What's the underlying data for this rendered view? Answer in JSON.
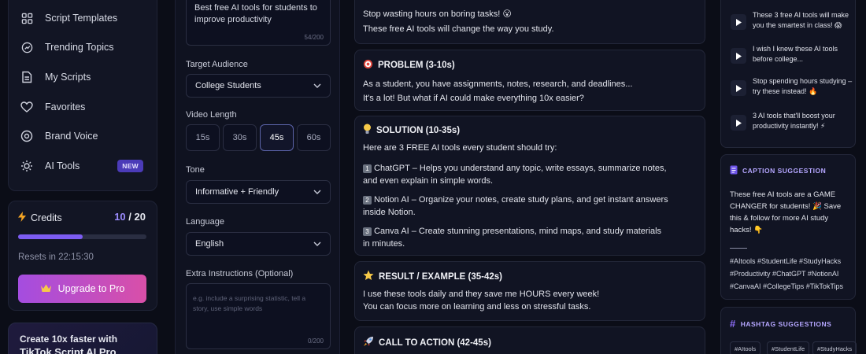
{
  "sidebar": {
    "items": [
      {
        "label": "Script Templates",
        "icon": "grid-icon"
      },
      {
        "label": "Trending Topics",
        "icon": "trending-icon"
      },
      {
        "label": "My Scripts",
        "icon": "document-icon"
      },
      {
        "label": "Favorites",
        "icon": "heart-icon"
      },
      {
        "label": "Brand Voice",
        "icon": "brand-icon"
      },
      {
        "label": "AI Tools",
        "icon": "sparkle-icon",
        "badge": "NEW"
      }
    ]
  },
  "credits": {
    "title": "Credits",
    "used": "10",
    "separator": "/",
    "total": "20",
    "progress_fraction": 0.5,
    "reset_text": "Resets in 22:15:30",
    "upgrade_label": "Upgrade to Pro"
  },
  "promo": {
    "line1": "Create 10x faster with",
    "line2": "TikTok Script AI Pro"
  },
  "form": {
    "topic_value": "Best free AI tools for students to improve productivity",
    "topic_count": "54/200",
    "audience_label": "Target Audience",
    "audience_value": "College Students",
    "length_label": "Video Length",
    "lengths": [
      "15s",
      "30s",
      "45s",
      "60s"
    ],
    "length_selected": "45s",
    "tone_label": "Tone",
    "tone_value": "Informative + Friendly",
    "language_label": "Language",
    "language_value": "English",
    "extra_label": "Extra Instructions (Optional)",
    "extra_placeholder": "e.g. include a surprising statistic, tell a story, use simple words",
    "extra_count": "0/200"
  },
  "script": {
    "hook_line1": "Stop wasting hours on boring tasks! 😮",
    "hook_line2": "These free AI tools will change the way you study.",
    "problem_title": "PROBLEM (3-10s)",
    "problem_line1": "As a student, you have assignments, notes, research, and deadlines...",
    "problem_line2": "It's a lot! But what if AI could make everything 10x easier?",
    "solution_title": "SOLUTION (10-35s)",
    "solution_intro": "Here are 3 FREE AI tools every student should try:",
    "tool1_num": "1",
    "tool1_line1": "ChatGPT – Helps you understand any topic, write essays, summarize notes,",
    "tool1_line2": "and even explain in simple words.",
    "tool2_num": "2",
    "tool2_line1": "Notion AI – Organize your notes, create study plans, and get instant answers",
    "tool2_line2": "inside Notion.",
    "tool3_num": "3",
    "tool3_line1": "Canva AI – Create stunning presentations, mind maps, and study materials",
    "tool3_line2": "in minutes.",
    "result_title": "RESULT / EXAMPLE (35-42s)",
    "result_line1": "I use these tools daily and they save me HOURS every week!",
    "result_line2": "You can focus more on learning and less on stressful tasks.",
    "cta_title": "CALL TO ACTION (42-45s)"
  },
  "videos": [
    {
      "title": "These 3 free AI tools will make you the smartest in class! 😱"
    },
    {
      "title": "I wish I knew these AI tools before college..."
    },
    {
      "title": "Stop spending hours studying – try these instead! 🔥"
    },
    {
      "title": "3 AI tools that'll boost your productivity instantly! ⚡"
    }
  ],
  "caption": {
    "title": "CAPTION SUGGESTION",
    "text": "These free AI tools are a GAME CHANGER for students! 🎉 Save this & follow for more AI study hacks! 👇",
    "hashtags": "#AItools #StudentLife #StudyHacks #Productivity #ChatGPT #NotionAI #CanvaAI #CollegeTips #TikTokTips"
  },
  "hashtags": {
    "title": "HASHTAG SUGGESTIONS",
    "chips": [
      "#AItools",
      "#StudentLife",
      "#StudyHacks"
    ]
  },
  "colors": {
    "accent": "#7c5cf2",
    "upgrade_start": "#a44de0",
    "upgrade_end": "#d94fa8",
    "background": "#0b0d17"
  }
}
